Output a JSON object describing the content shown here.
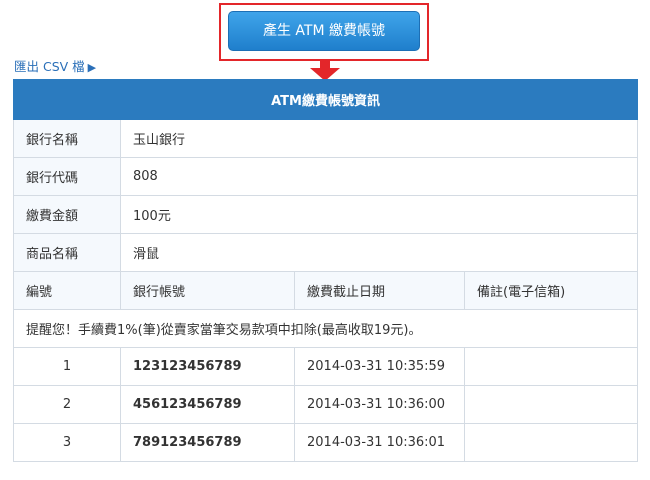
{
  "actions": {
    "generate_label": "產生 ATM 繳費帳號",
    "export_label": "匯出 CSV 檔",
    "export_arrow": "▶"
  },
  "info": {
    "title": "ATM繳費帳號資訊",
    "rows": [
      {
        "label": "銀行名稱",
        "value": "玉山銀行"
      },
      {
        "label": "銀行代碼",
        "value": "808"
      },
      {
        "label": "繳費金額",
        "value": "100元"
      },
      {
        "label": "商品名稱",
        "value": "滑鼠"
      }
    ]
  },
  "accounts": {
    "headers": [
      "編號",
      "銀行帳號",
      "繳費截止日期",
      "備註(電子信箱)"
    ],
    "notice": "提醒您！手續費1%(筆)從賣家當筆交易款項中扣除(最高收取19元)。",
    "rows": [
      {
        "no": "1",
        "account": "123123456789",
        "deadline": "2014-03-31 10:35:59",
        "note": ""
      },
      {
        "no": "2",
        "account": "456123456789",
        "deadline": "2014-03-31 10:36:00",
        "note": ""
      },
      {
        "no": "3",
        "account": "789123456789",
        "deadline": "2014-03-31 10:36:01",
        "note": ""
      }
    ]
  },
  "colors": {
    "header_blue": "#2b7bbf",
    "highlight_red": "#e3262a",
    "notice_red": "#d9332e",
    "link_blue": "#2a6fb8"
  }
}
